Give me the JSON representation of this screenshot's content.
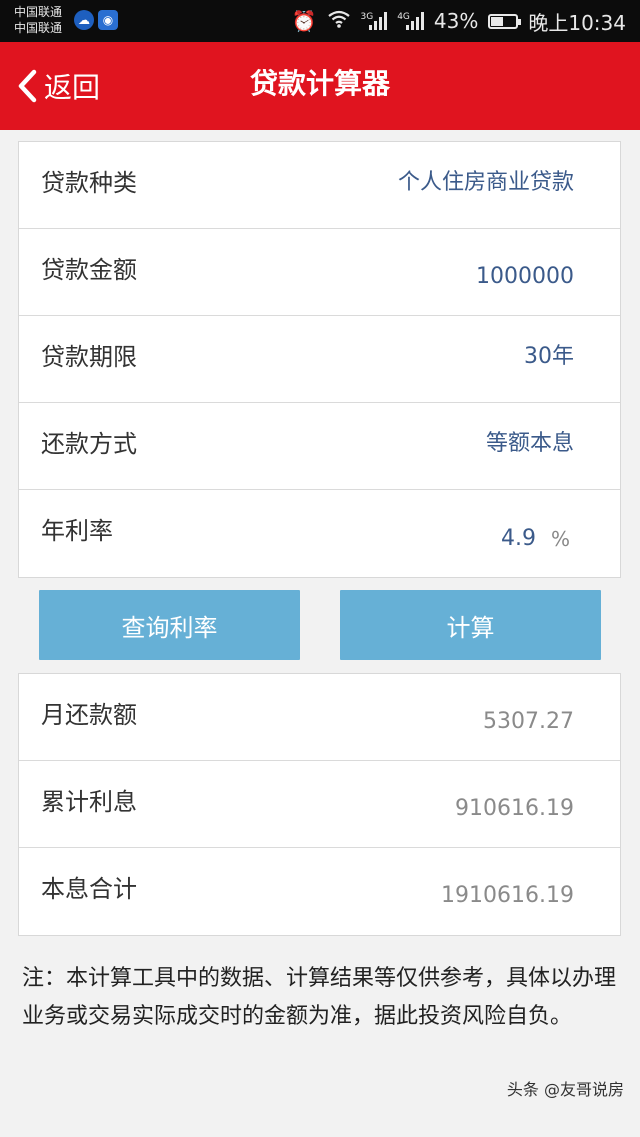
{
  "status_bar": {
    "carrier1": "中国联通",
    "carrier2": "中国联通",
    "net1": "3G",
    "net2": "4G",
    "battery": "43%",
    "time": "晚上10:34"
  },
  "header": {
    "back_label": "返回",
    "title": "贷款计算器"
  },
  "form": {
    "rows": [
      {
        "label": "贷款种类",
        "value": "个人住房商业贷款"
      },
      {
        "label": "贷款金额",
        "value": "1000000"
      },
      {
        "label": "贷款期限",
        "value": "30年"
      },
      {
        "label": "还款方式",
        "value": "等额本息"
      },
      {
        "label": "年利率",
        "value": "4.9",
        "unit": "%"
      }
    ]
  },
  "buttons": {
    "query_rate": "查询利率",
    "calculate": "计算"
  },
  "results": {
    "rows": [
      {
        "label": "月还款额",
        "value": "5307.27"
      },
      {
        "label": "累计利息",
        "value": "910616.19"
      },
      {
        "label": "本息合计",
        "value": "1910616.19"
      }
    ]
  },
  "note": "注：本计算工具中的数据、计算结果等仅供参考，具体以办理业务或交易实际成交时的金额为准，据此投资风险自负。",
  "watermark": "头条 @友哥说房",
  "colors": {
    "header_bg": "#e0141f",
    "button_bg": "#66b0d6",
    "value_text": "#3b5a8a"
  }
}
